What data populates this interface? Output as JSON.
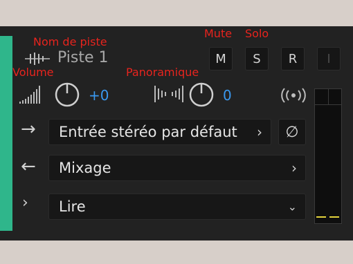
{
  "annotations": {
    "track_name": "Nom de piste",
    "mute": "Mute",
    "solo": "Solo",
    "volume": "Volume",
    "pan": "Panoramique"
  },
  "track": {
    "name": "Piste 1",
    "color": "#2fb68b"
  },
  "buttons": {
    "mute": "M",
    "solo": "S",
    "record": "R",
    "input_monitor": "I"
  },
  "volume": {
    "value": "+0"
  },
  "pan": {
    "value": "0"
  },
  "input": {
    "label": "Entrée stéréo par défaut"
  },
  "output": {
    "label": "Mixage"
  },
  "automation": {
    "label": "Lire"
  },
  "colors": {
    "accent": "#3a99f0",
    "annotation": "#e8251f",
    "meter_peak": "#e4d43c"
  }
}
